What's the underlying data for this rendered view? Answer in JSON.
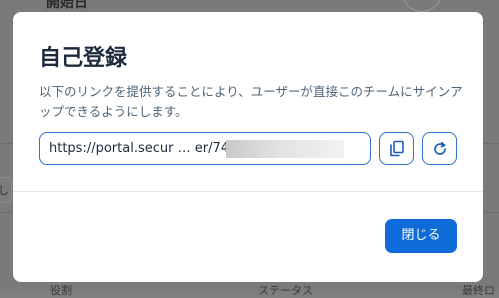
{
  "background": {
    "page_title": "開始日",
    "left_input_text": "し",
    "columns": [
      "役割",
      "ステータス",
      "最終ロ"
    ]
  },
  "modal": {
    "title": "自己登録",
    "description": "以下のリンクを提供することにより、ユーザーが直接このチームにサインアップできるようにします。",
    "url_value": "https://portal.secur … er/741",
    "copy_icon": "copy-icon",
    "refresh_icon": "refresh-icon",
    "close_label": "閉じる"
  },
  "colors": {
    "accent": "#0f6bd8",
    "border_accent": "#2d6fc9",
    "title": "#1d2b3d",
    "description": "#4f6378"
  }
}
